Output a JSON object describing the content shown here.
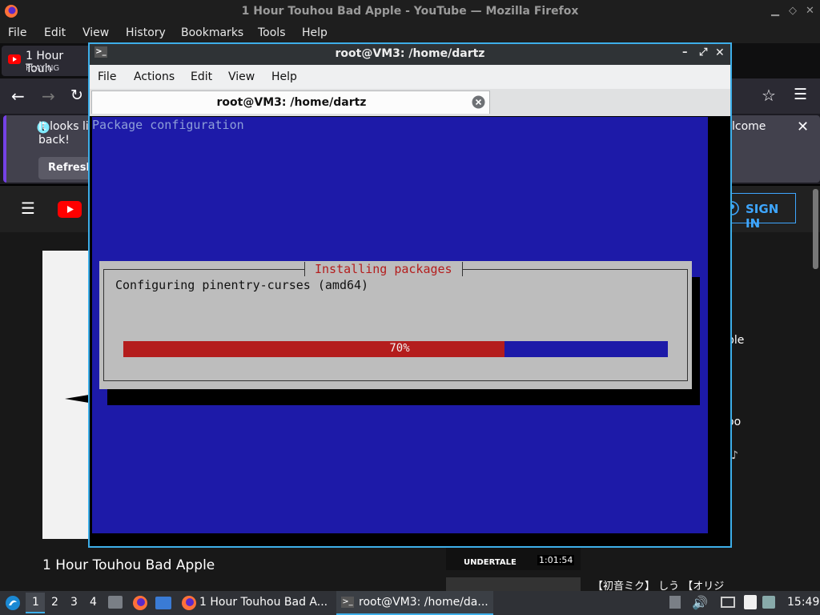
{
  "firefox": {
    "window_title": "1 Hour Touhou Bad Apple - YouTube — Mozilla Firefox",
    "menu": [
      "File",
      "Edit",
      "View",
      "History",
      "Bookmarks",
      "Tools",
      "Help"
    ],
    "tab": {
      "title": "1 Hour Touh",
      "status": "PLAYING"
    },
    "notification": {
      "text_left": "It looks lik",
      "text_left2": "back!",
      "text_right": "lcome",
      "refresh_button": "Refresh"
    }
  },
  "youtube": {
    "sign_in": "SIGN IN",
    "video_title": "1 Hour Touhou Bad Apple",
    "side_text_1": "ble",
    "side_text_2": "oo",
    "thumb_label": "UNDERTALE",
    "thumb_duration": "1:01:54",
    "next_title": "【初音ミク】 しう 【オリジ"
  },
  "terminal": {
    "window_title": "root@VM3: /home/dartz",
    "menu": [
      "File",
      "Actions",
      "Edit",
      "View",
      "Help"
    ],
    "tab_title": "root@VM3: /home/dartz",
    "screen_header": "Package configuration",
    "dialog_title": "Installing packages",
    "dialog_message": "Configuring pinentry-curses (amd64)",
    "progress_label": "70%",
    "progress_fraction": 0.7
  },
  "taskbar": {
    "workspaces": [
      "1",
      "2",
      "3",
      "4"
    ],
    "tasks": [
      {
        "label": "1 Hour Touhou Bad A..."
      },
      {
        "label": "root@VM3: /home/da..."
      }
    ],
    "clock": "15:49"
  },
  "colors": {
    "dialog_blue": "#1d1aa8",
    "progress_red": "#b41d1d",
    "title_red": "#b41d1d",
    "header_text": "#8e9fd8",
    "accent": "#3daee9"
  }
}
